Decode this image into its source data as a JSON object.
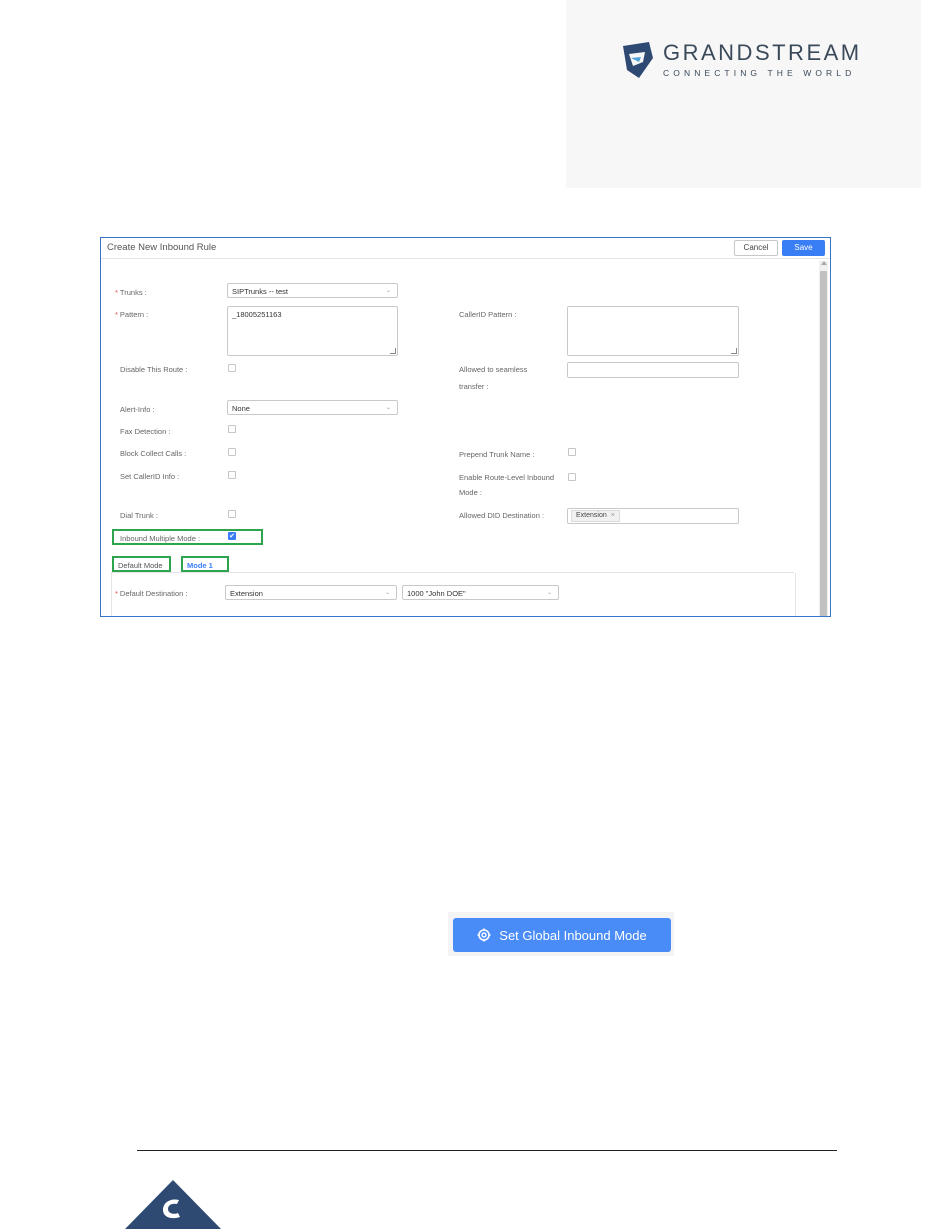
{
  "brand": {
    "name": "GRANDSTREAM",
    "tagline": "CONNECTING THE WORLD"
  },
  "dialog": {
    "title": "Create New Inbound Rule",
    "cancel_label": "Cancel",
    "save_label": "Save"
  },
  "form": {
    "trunks": {
      "label": "Trunks :",
      "value": "SIPTrunks -- test"
    },
    "pattern": {
      "label": "Pattern :",
      "value": "_18005251163"
    },
    "callerid_pattern": {
      "label": "CallerID Pattern :",
      "value": ""
    },
    "disable_route": {
      "label": "Disable This Route :",
      "checked": false
    },
    "seamless_transfer": {
      "label_line1": "Allowed to seamless",
      "label_line2": "transfer :",
      "value": ""
    },
    "alert_info": {
      "label": "Alert-Info :",
      "value": "None"
    },
    "fax_detection": {
      "label": "Fax Detection :",
      "checked": false
    },
    "block_collect": {
      "label": "Block Collect Calls :",
      "checked": false
    },
    "prepend_trunk": {
      "label": "Prepend Trunk Name :",
      "checked": false
    },
    "set_callerid": {
      "label": "Set CallerID Info :",
      "checked": false
    },
    "route_level_inbound": {
      "label_line1": "Enable Route-Level Inbound",
      "label_line2": "Mode :",
      "checked": false
    },
    "dial_trunk": {
      "label": "Dial Trunk :",
      "checked": false
    },
    "allowed_did": {
      "label": "Allowed DID Destination :",
      "tag": "Extension",
      "tag_close": "×"
    },
    "inbound_multiple": {
      "label": "Inbound Multiple Mode :",
      "checked": true,
      "check_glyph": "✔"
    }
  },
  "tabs": [
    {
      "label": "Default Mode",
      "active": false
    },
    {
      "label": "Mode 1",
      "active": true
    }
  ],
  "default_destination": {
    "label": "Default Destination :",
    "type_value": "Extension",
    "target_value": "1000 \"John DOE\""
  },
  "global_button": {
    "label": "Set Global Inbound Mode"
  },
  "colors": {
    "accent": "#3a7ef6",
    "highlight": "#2ea44f",
    "required": "#e04a4a",
    "brand": "#3b4a5a",
    "footer": "#2f4a72"
  }
}
